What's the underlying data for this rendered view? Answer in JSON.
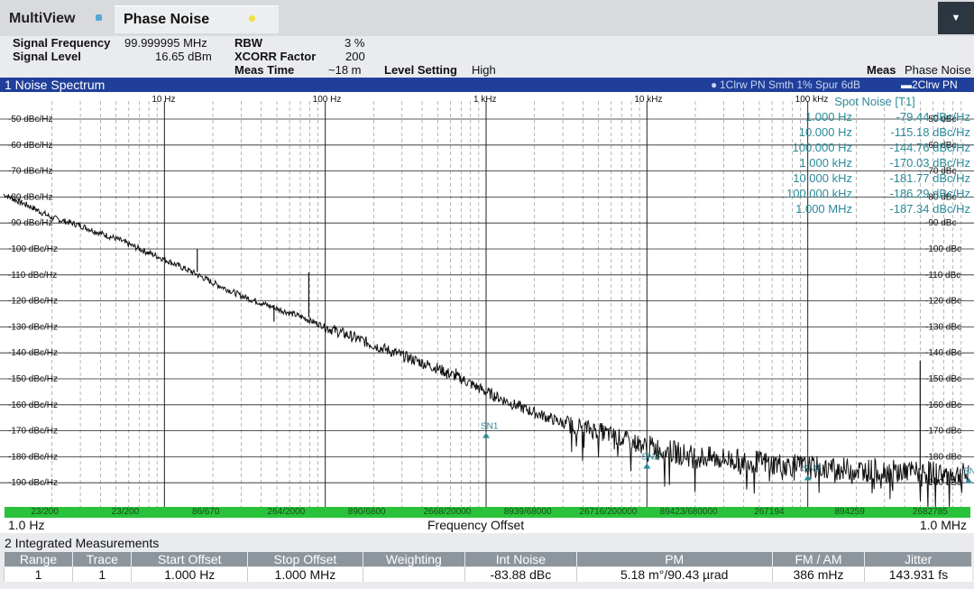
{
  "tabs": {
    "multiview": "MultiView",
    "phase_noise": "Phase Noise"
  },
  "settings": {
    "signal_frequency_label": "Signal Frequency",
    "signal_frequency_value": "99.999995 MHz",
    "signal_level_label": "Signal Level",
    "signal_level_value": "16.65 dBm",
    "rbw_label": "RBW",
    "rbw_value": "3 %",
    "xcorr_label": "XCORR Factor",
    "xcorr_value": "200",
    "meas_time_label": "Meas Time",
    "meas_time_value": "~18 m",
    "level_setting_label": "Level Setting",
    "level_setting_value": "High",
    "meas_label": "Meas",
    "meas_value": "Phase Noise"
  },
  "pane": {
    "title": "1 Noise Spectrum",
    "trace1_info": "1Clrw PN Smth 1% Spur 6dB",
    "trace2_info": "2Clrw PN"
  },
  "colors": {
    "title_bar": "#1f3f9a",
    "green_bar": "#29c23a",
    "teal_text": "#2a8a9a",
    "trace": "#111111",
    "header_cell": "#8d959d"
  },
  "chart_data": {
    "type": "line",
    "x_scale": "log",
    "xlim_hz": [
      1,
      1000000
    ],
    "ylim_dbc": [
      -195,
      -45
    ],
    "x_tick_labels": [
      "10 Hz",
      "100 Hz",
      "1 kHz",
      "10 kHz",
      "100 kHz"
    ],
    "y_tick_labels_left": [
      "-50 dBc/Hz",
      "-60 dBc/Hz",
      "-70 dBc/Hz",
      "-80 dBc/Hz",
      "-90 dBc/Hz",
      "-100 dBc/Hz",
      "-110 dBc/Hz",
      "-120 dBc/Hz",
      "-130 dBc/Hz",
      "-140 dBc/Hz",
      "-150 dBc/Hz",
      "-160 dBc/Hz",
      "-170 dBc/Hz",
      "-180 dBc/Hz",
      "-190 dBc/Hz"
    ],
    "y_tick_labels_right": [
      "-50 dBc",
      "-60 dBc",
      "-70 dBc",
      "-80 dBc",
      "-90 dBc",
      "-100 dBc",
      "-110 dBc",
      "-120 dBc",
      "-130 dBc",
      "-140 dBc",
      "-150 dBc",
      "-160 dBc",
      "-170 dBc",
      "-180 dBc",
      "-190 dBc"
    ],
    "y_ticks": [
      -50,
      -60,
      -70,
      -80,
      -90,
      -100,
      -110,
      -120,
      -130,
      -140,
      -150,
      -160,
      -170,
      -180,
      -190
    ],
    "x_ticks_hz": [
      10,
      100,
      1000,
      10000,
      100000
    ],
    "series": [
      {
        "x": [
          1,
          1.5,
          2,
          3,
          4,
          5,
          7,
          10,
          15,
          20,
          30,
          50,
          70,
          100,
          150,
          200,
          300,
          500,
          700,
          1000,
          1500,
          2000,
          3000,
          5000,
          7000,
          10000,
          20000,
          50000,
          100000,
          200000,
          500000,
          1000000
        ],
        "y": [
          -79,
          -84,
          -88,
          -91,
          -94,
          -96,
          -100,
          -104,
          -109,
          -113,
          -118,
          -123,
          -126,
          -130,
          -134,
          -137,
          -141,
          -146,
          -150,
          -155,
          -160,
          -163,
          -167,
          -170,
          -173,
          -176,
          -180,
          -182,
          -184,
          -185,
          -186,
          -187
        ]
      }
    ],
    "spurs": [
      {
        "x": 16,
        "y": -100
      },
      {
        "x": 48,
        "y": -128
      },
      {
        "x": 79,
        "y": -109
      },
      {
        "x": 570,
        "y": -150
      },
      {
        "x": 650,
        "y": -146
      },
      {
        "x": 720,
        "y": -151
      },
      {
        "x": 500000,
        "y": -143
      }
    ],
    "markers": [
      {
        "label": "SN1",
        "x": 1000,
        "y": -170.03
      },
      {
        "label": "SN2",
        "x": 10000,
        "y": -181.77
      },
      {
        "label": "SN3",
        "x": 100000,
        "y": -186.29
      },
      {
        "label": "SN4",
        "x": 1000000,
        "y": -187.34
      }
    ],
    "x_start_label": "1.0 Hz",
    "x_stop_label": "1.0 MHz",
    "x_axis_label": "Frequency Offset",
    "green_bar_labels": [
      "23/200",
      "23/200",
      "86/670",
      "264/2000",
      "890/6800",
      "2668/20000",
      "8939/68000",
      "26716/200000",
      "89423/680000",
      "267194",
      "894259",
      "2682785"
    ]
  },
  "spot_noise": {
    "title": "Spot Noise [T1]",
    "rows": [
      {
        "freq": "1.000 Hz",
        "value": "-79.44 dBc/Hz"
      },
      {
        "freq": "10.000 Hz",
        "value": "-115.18 dBc/Hz"
      },
      {
        "freq": "100.000 Hz",
        "value": "-144.76 dBc/Hz"
      },
      {
        "freq": "1.000 kHz",
        "value": "-170.03 dBc/Hz"
      },
      {
        "freq": "10.000 kHz",
        "value": "-181.77 dBc/Hz"
      },
      {
        "freq": "100.000 kHz",
        "value": "-186.29 dBc/Hz"
      },
      {
        "freq": "1.000 MHz",
        "value": "-187.34 dBc/Hz"
      }
    ]
  },
  "integrated": {
    "title": "2 Integrated Measurements",
    "headers": [
      "Range",
      "Trace",
      "Start Offset",
      "Stop Offset",
      "Weighting",
      "Int Noise",
      "PM",
      "FM / AM",
      "Jitter"
    ],
    "row": [
      "1",
      "1",
      "1.000 Hz",
      "1.000 MHz",
      "",
      "-83.88 dBc",
      "5.18 m°/90.43 µrad",
      "386 mHz",
      "143.931 fs"
    ]
  }
}
